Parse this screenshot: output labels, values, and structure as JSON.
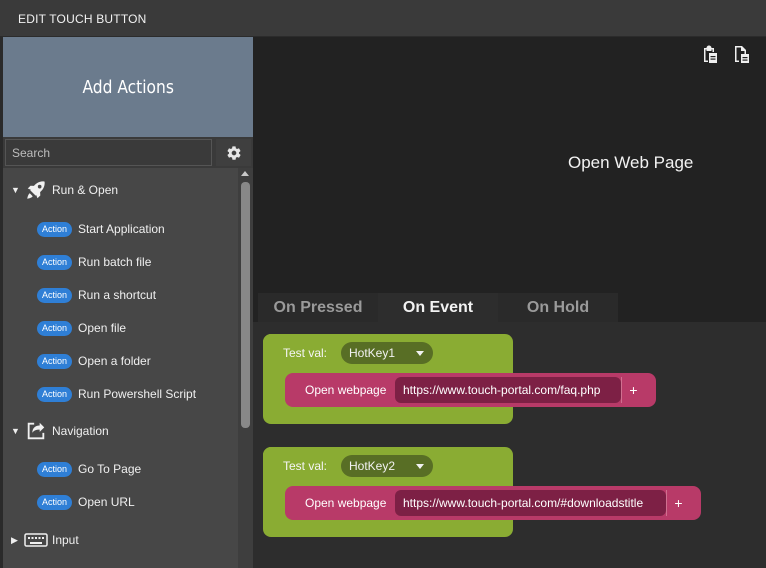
{
  "window": {
    "title": "EDIT TOUCH BUTTON"
  },
  "sidebar": {
    "header": "Add Actions",
    "search": {
      "placeholder": "Search",
      "value": ""
    },
    "categories": [
      {
        "label": "Run & Open",
        "icon": "rocket-icon",
        "expanded": true,
        "items": [
          {
            "badge": "Action",
            "label": "Start Application"
          },
          {
            "badge": "Action",
            "label": "Run batch file"
          },
          {
            "badge": "Action",
            "label": "Run a shortcut"
          },
          {
            "badge": "Action",
            "label": "Open file"
          },
          {
            "badge": "Action",
            "label": "Open a folder"
          },
          {
            "badge": "Action",
            "label": "Run Powershell Script"
          }
        ]
      },
      {
        "label": "Navigation",
        "icon": "share-arrow-icon",
        "expanded": true,
        "items": [
          {
            "badge": "Action",
            "label": "Go To Page"
          },
          {
            "badge": "Action",
            "label": "Open URL"
          }
        ]
      },
      {
        "label": "Input",
        "icon": "keyboard-icon",
        "expanded": false,
        "items": []
      }
    ]
  },
  "preview": {
    "button_text": "Open Web Page"
  },
  "tabs": [
    {
      "label": "On Pressed",
      "active": false
    },
    {
      "label": "On Event",
      "active": true
    },
    {
      "label": "On Hold",
      "active": false
    }
  ],
  "events": [
    {
      "test_label": "Test val:",
      "selected": "HotKey1",
      "action_label": "Open webpage",
      "url": "https://www.touch-portal.com/faq.php",
      "plus": "+"
    },
    {
      "test_label": "Test val:",
      "selected": "HotKey2",
      "action_label": "Open webpage",
      "url": "https://www.touch-portal.com/#downloadstitle",
      "plus": "+"
    }
  ],
  "colors": {
    "header_bg": "#6b7b8d",
    "badge": "#2f7fd6",
    "event_block": "#8aac33",
    "action_block": "#b83a68"
  }
}
